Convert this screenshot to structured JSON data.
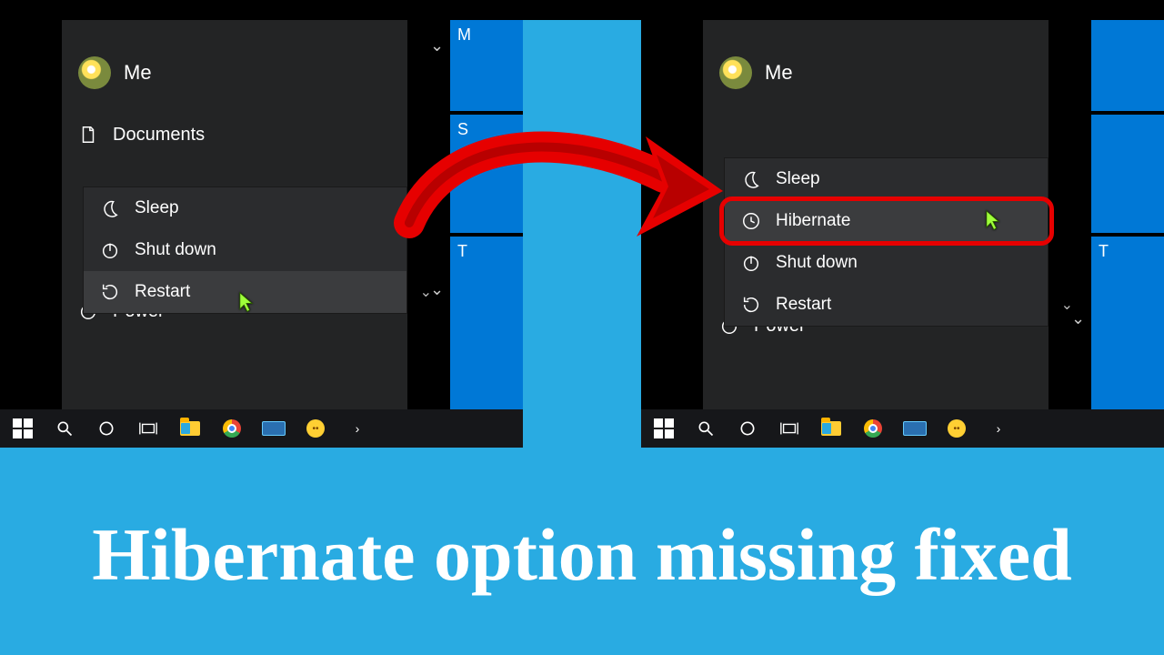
{
  "caption": "Hibernate option missing fixed",
  "left": {
    "user": "Me",
    "sidebar": {
      "documents": "Documents",
      "power": "Power"
    },
    "menu": [
      {
        "icon": "moon",
        "label": "Sleep"
      },
      {
        "icon": "power",
        "label": "Shut down"
      },
      {
        "icon": "restart",
        "label": "Restart",
        "selected": true
      }
    ],
    "tiles": [
      "M",
      "S",
      "T"
    ]
  },
  "right": {
    "user": "Me",
    "sidebar": {
      "power": "Power"
    },
    "menu": [
      {
        "icon": "moon",
        "label": "Sleep"
      },
      {
        "icon": "clock",
        "label": "Hibernate",
        "selected": true,
        "highlight": true
      },
      {
        "icon": "power",
        "label": "Shut down"
      },
      {
        "icon": "restart",
        "label": "Restart"
      }
    ],
    "tiles": [
      "",
      "",
      "T"
    ]
  }
}
